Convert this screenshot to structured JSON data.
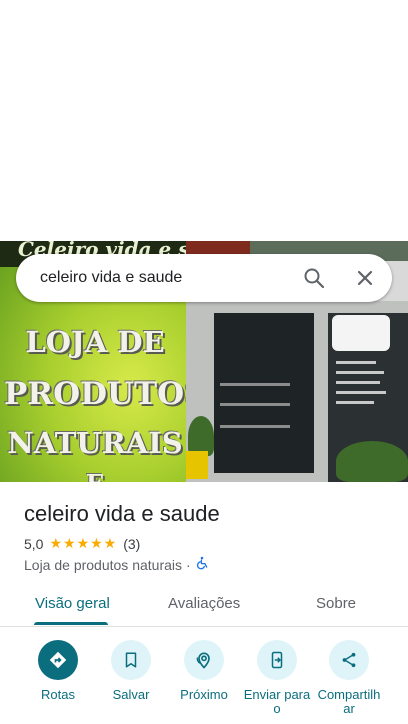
{
  "search": {
    "query": "celeiro vida e saude"
  },
  "photo": {
    "banner_text": "Celeiro vida e saude",
    "big_lines": [
      "LOJA DE",
      "PRODUTOS",
      "NATURAIS",
      "E"
    ]
  },
  "place": {
    "name": "celeiro vida e saude",
    "rating": "5,0",
    "stars": "★★★★★",
    "review_count": "(3)",
    "category": "Loja de produtos naturais",
    "separator": "·",
    "accessibility_icon": "wheelchair-icon"
  },
  "tabs": [
    {
      "label": "Visão geral",
      "active": true
    },
    {
      "label": "Avaliações",
      "active": false
    },
    {
      "label": "Sobre",
      "active": false
    }
  ],
  "actions": [
    {
      "label": "Rotas",
      "icon": "directions-icon"
    },
    {
      "label": "Salvar",
      "icon": "bookmark-icon"
    },
    {
      "label": "Próximo",
      "icon": "nearby-icon"
    },
    {
      "label": "Enviar para o",
      "icon": "send-to-phone-icon"
    },
    {
      "label": "Compartilhar",
      "icon": "share-icon"
    }
  ],
  "colors": {
    "accent": "#0b6e7e",
    "star": "#f9ab00",
    "chip": "#dff4f8"
  }
}
